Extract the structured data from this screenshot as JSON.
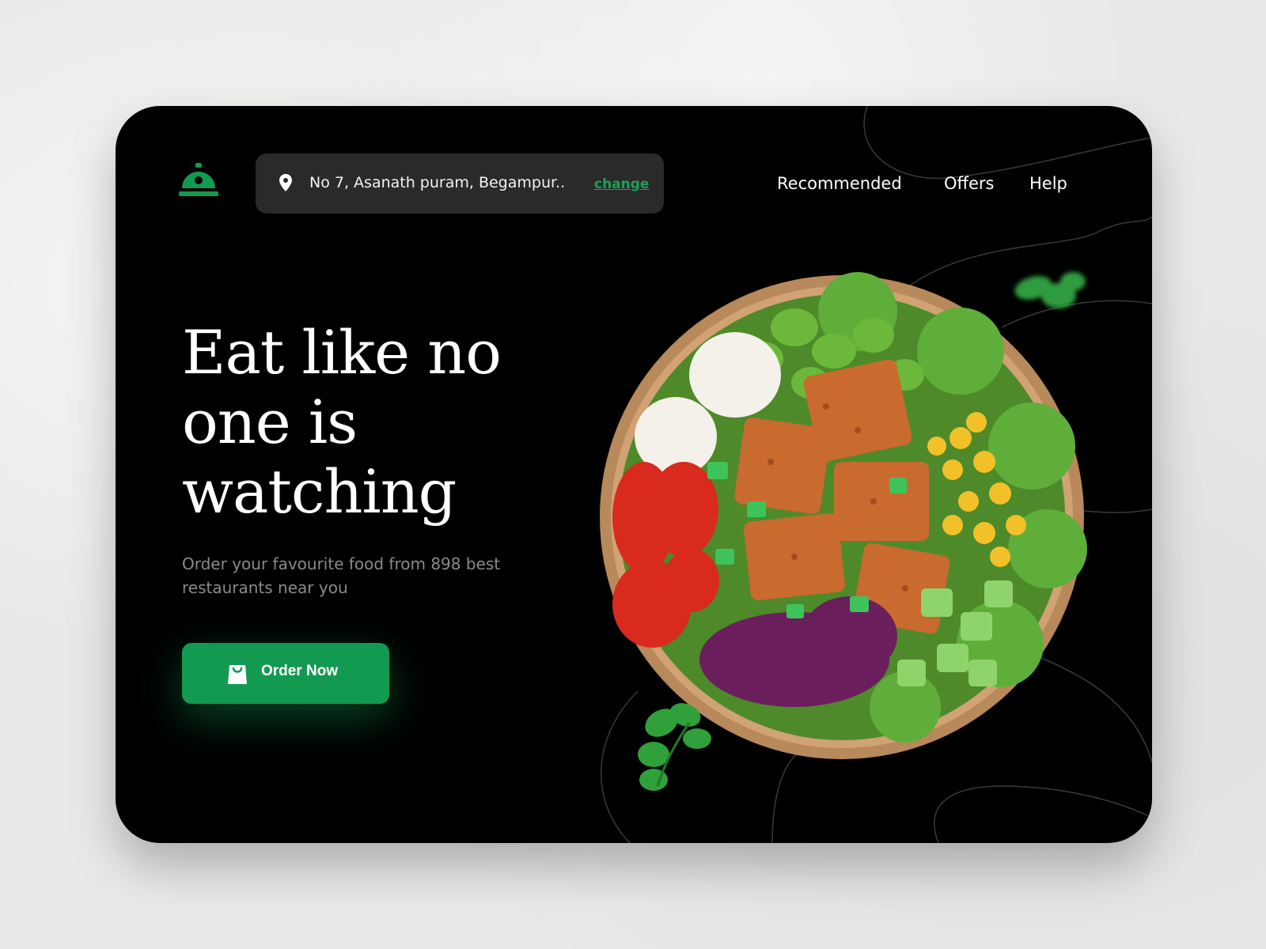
{
  "logo": {
    "icon": "cloche-icon",
    "color": "#129a50"
  },
  "location": {
    "icon": "location-pin-icon",
    "address": "No 7, Asanath puram, Begampur..",
    "change_label": "change"
  },
  "nav": {
    "recommended": "Recommended",
    "offers": "Offers",
    "help": "Help"
  },
  "hero": {
    "title": "Eat like no one is watching",
    "subtitle": "Order your favourite food from 898 best restaurants near you",
    "cta_label": "Order Now",
    "cta_icon": "shopping-bag-icon"
  },
  "colors": {
    "accent": "#129a50",
    "card_background": "#000000",
    "address_bar": "#2a2a2a"
  }
}
